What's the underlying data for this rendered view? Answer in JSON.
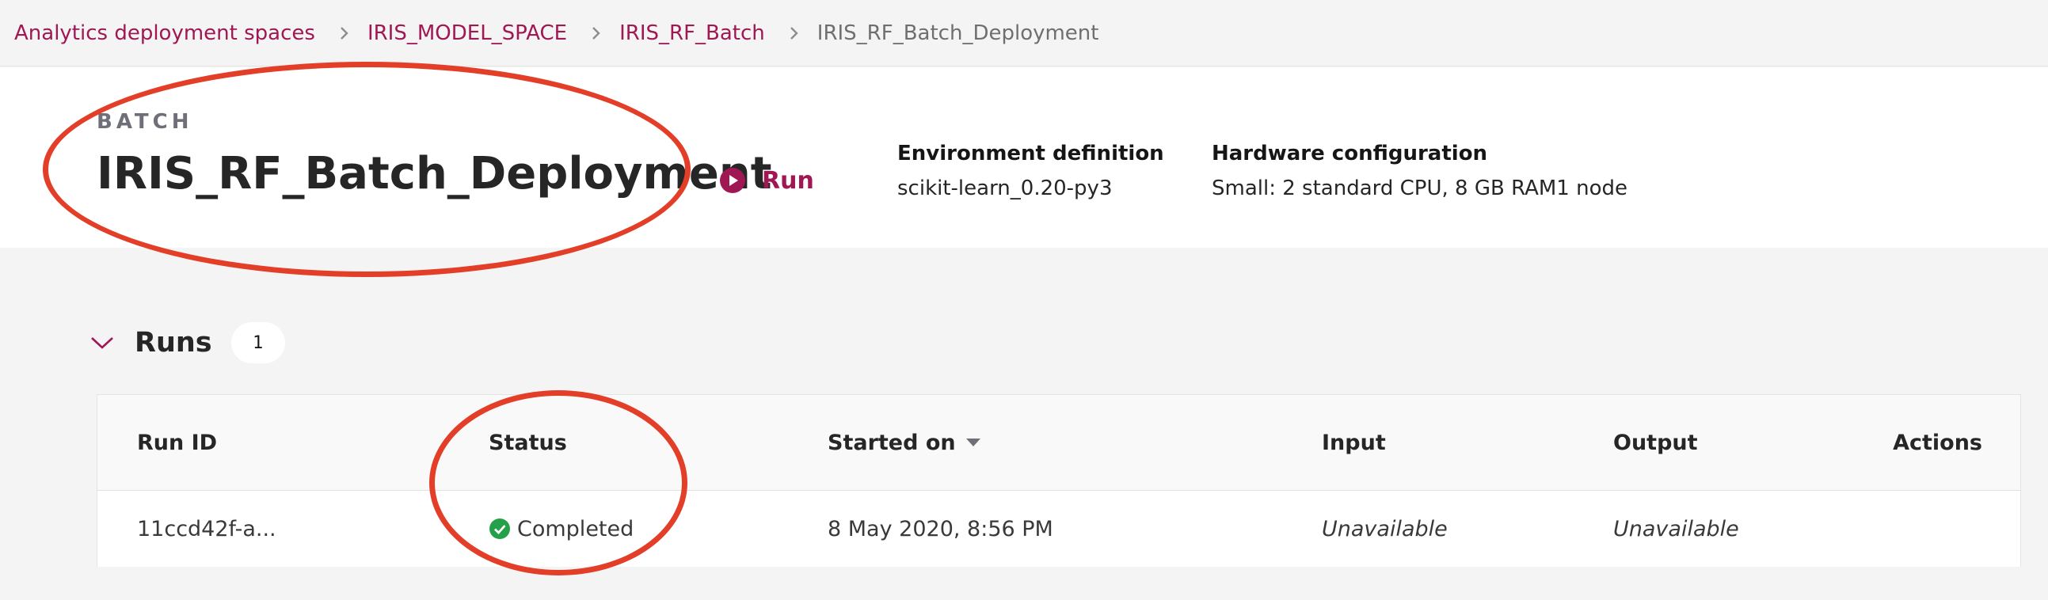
{
  "breadcrumb": {
    "items": [
      {
        "label": "Analytics deployment spaces"
      },
      {
        "label": "IRIS_MODEL_SPACE"
      },
      {
        "label": "IRIS_RF_Batch"
      },
      {
        "label": "IRIS_RF_Batch_Deployment"
      }
    ]
  },
  "header": {
    "kind": "BATCH",
    "title": "IRIS_RF_Batch_Deployment",
    "run_label": "Run",
    "environment": {
      "label": "Environment definition",
      "value": "scikit-learn_0.20-py3"
    },
    "hardware": {
      "label": "Hardware configuration",
      "value": "Small: 2 standard CPU, 8 GB RAM1 node"
    }
  },
  "runs": {
    "title": "Runs",
    "count": "1",
    "columns": [
      "Run ID",
      "Status",
      "Started on",
      "Input",
      "Output",
      "Actions"
    ],
    "rows": [
      {
        "run_id": "11ccd42f-a...",
        "status": "Completed",
        "started_on": "8 May 2020, 8:56 PM",
        "input": "Unavailable",
        "output": "Unavailable"
      }
    ]
  },
  "colors": {
    "accent": "#9f1853",
    "success": "#24a148",
    "annotation": "#e23e28"
  },
  "icons": {
    "separator": "chevron-right-icon",
    "run": "play-circle-icon",
    "collapse": "chevron-down-icon",
    "sort": "caret-down-icon",
    "status": "checkmark-filled-icon"
  }
}
